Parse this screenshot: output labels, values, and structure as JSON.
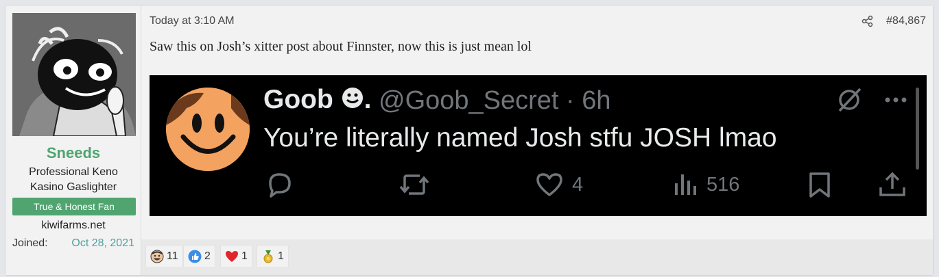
{
  "user": {
    "name": "Sneeds",
    "title_line1": "Professional Keno",
    "title_line2": "Kasino Gaslighter",
    "banner": "True & Honest Fan",
    "site": "kiwifarms.net",
    "joined_label": "Joined:",
    "joined_value": "Oct 28, 2021"
  },
  "post": {
    "timestamp": "Today at 3:10 AM",
    "number": "#84,867",
    "message": "Saw this on Josh’s xitter post about Finnster, now this is just mean lol"
  },
  "tweet": {
    "display_name": "Goob",
    "name_suffix": ".",
    "handle_time": "@Goob_Secret · 6h",
    "text": "You’re literally named Josh stfu JOSH lmao",
    "likes": "4",
    "views": "516"
  },
  "reactions": [
    {
      "icon": "laughing-face-icon",
      "count": "11"
    },
    {
      "icon": "thumbs-up-icon",
      "count": "2"
    },
    {
      "icon": "heart-icon",
      "count": "1"
    },
    {
      "icon": "gold-medal-icon",
      "count": "1"
    }
  ],
  "colors": {
    "username": "#50a470",
    "banner_bg": "#50a470",
    "joined_value": "#4ea0a0",
    "tweet_bg": "#000000",
    "tweet_text": "#e7e9ea",
    "tweet_muted": "#71767b"
  }
}
